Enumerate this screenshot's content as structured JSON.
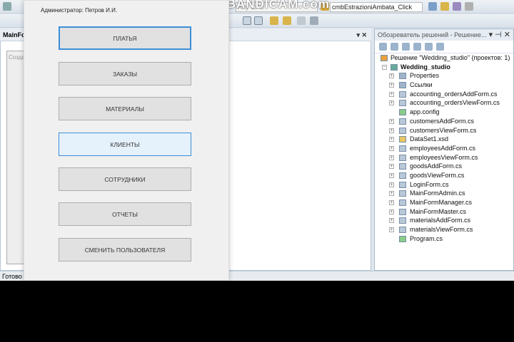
{
  "watermark": "www.BANDICAM.com",
  "toolbar": {
    "platform": "Any CPU",
    "method": "cmbEstrazioniAmbata_Click"
  },
  "document": {
    "tab": "MainFo",
    "close": "▾ ✕",
    "designer_label": "Созда"
  },
  "solution_explorer": {
    "title": "Обозреватель решений - Решение...",
    "controls": "▾ ⊣ ✕",
    "solution": "Решение \"Wedding_studio\"  (проектов: 1)",
    "project": "Wedding_studio",
    "items": [
      "Properties",
      "Ссылки",
      "accounting_ordersAddForm.cs",
      "accounting_ordersViewForm.cs",
      "app.config",
      "customersAddForm.cs",
      "customersViewForm.cs",
      "DataSet1.xsd",
      "employeesAddForm.cs",
      "employeesViewForm.cs",
      "goodsAddForm.cs",
      "goodsViewForm.cs",
      "LoginForm.cs",
      "MainFormAdmin.cs",
      "MainFormManager.cs",
      "MainFormMaster.cs",
      "materialsAddForm.cs",
      "materialsViewForm.cs",
      "Program.cs"
    ]
  },
  "status": "Готово",
  "form": {
    "admin_label": "Администратор: Петров И.И.",
    "buttons": [
      "ПЛАТЬЯ",
      "ЗАКАЗЫ",
      "МАТЕРИАЛЫ",
      "КЛИЕНТЫ",
      "СОТРУДНИКИ",
      "ОТЧЕТЫ",
      "СМЕНИТЬ ПОЛЬЗОВАТЕЛЯ"
    ]
  }
}
